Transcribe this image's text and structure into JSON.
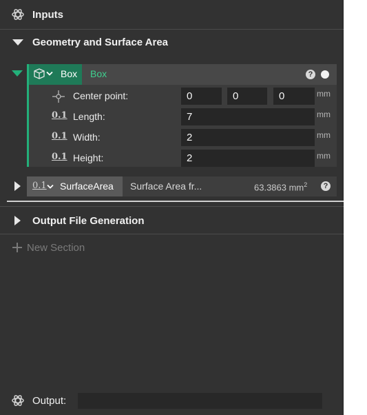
{
  "header": {
    "title": "Inputs",
    "icon": "openai-knot-icon"
  },
  "section1": {
    "title": "Geometry and Surface Area",
    "expanded": true,
    "component": {
      "name": "Box",
      "alias": "Box",
      "icon": "cube-icon",
      "help": "?",
      "params": [
        {
          "icon": "point-icon",
          "label": "Center point:",
          "values": [
            "0",
            "0",
            "0"
          ],
          "unit": "mm"
        },
        {
          "icon": "number-icon",
          "icon_text": "0.1",
          "label": "Length:",
          "value": "7",
          "unit": "mm"
        },
        {
          "icon": "number-icon",
          "icon_text": "0.1",
          "label": "Width:",
          "value": "2",
          "unit": "mm"
        },
        {
          "icon": "number-icon",
          "icon_text": "0.1",
          "label": "Height:",
          "value": "2",
          "unit": "mm"
        }
      ]
    },
    "output_row": {
      "icon_text": "0.1",
      "name": "SurfaceArea",
      "description": "Surface Area fr...",
      "value": "63.3863 mm",
      "value_sup": "2",
      "help": "?"
    }
  },
  "section2": {
    "title": "Output File Generation",
    "expanded": false
  },
  "new_section": {
    "label": "New Section",
    "icon": "plus-icon"
  },
  "footer": {
    "label": "Output:",
    "icon": "openai-knot-icon",
    "value": ""
  },
  "colors": {
    "panel": "#323232",
    "accent": "#23b07a",
    "accent_text": "#3fd08f",
    "field": "#262626"
  }
}
